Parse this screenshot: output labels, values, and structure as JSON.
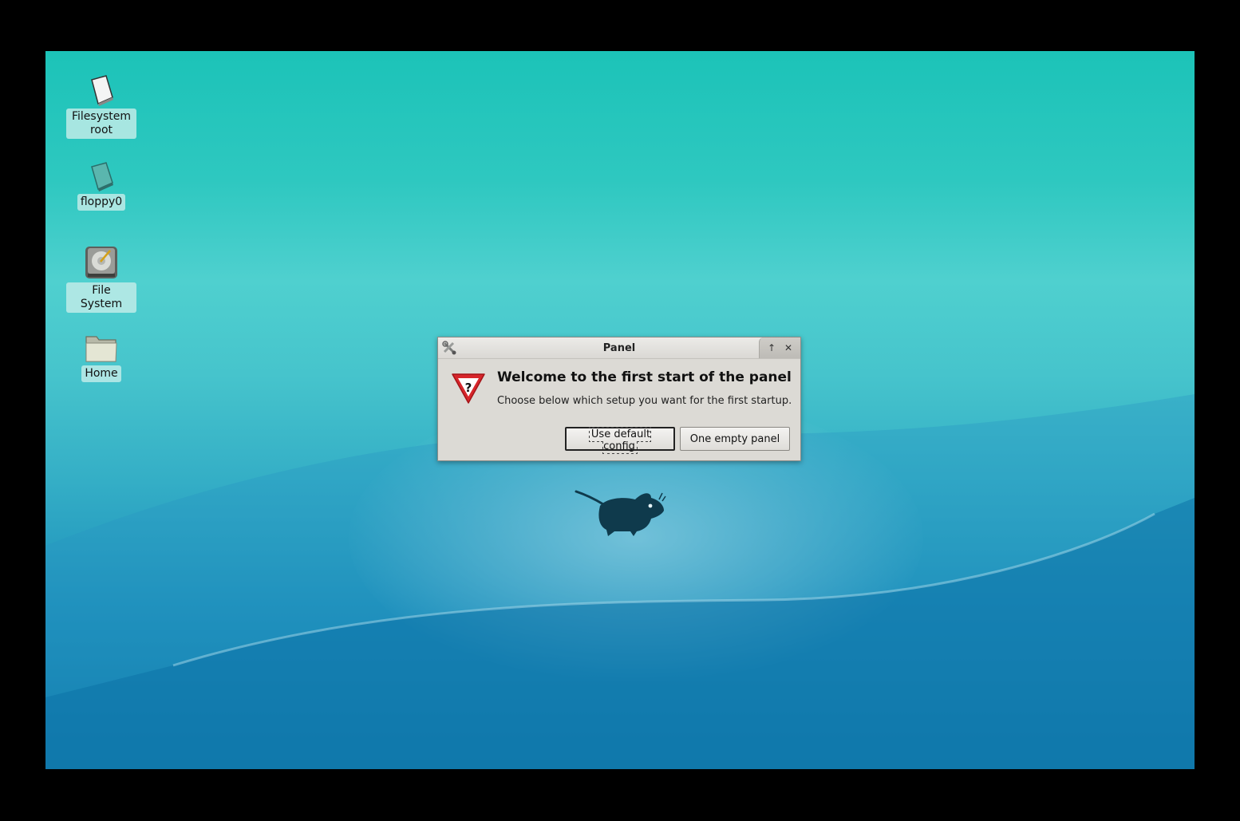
{
  "desktop": {
    "icons": [
      {
        "label": "Filesystem root",
        "icon": "drive-icon"
      },
      {
        "label": "floppy0",
        "icon": "floppy-icon"
      },
      {
        "label": "File System",
        "icon": "harddisk-icon"
      },
      {
        "label": "Home",
        "icon": "folder-icon"
      }
    ]
  },
  "dialog": {
    "title": "Panel",
    "heading": "Welcome to the first start of the panel",
    "message": "Choose below which setup you want for the first startup.",
    "buttons": {
      "default_config": "Use default config",
      "empty_panel": "One empty panel"
    },
    "titlebar_buttons": {
      "maximize": "↑",
      "close": "✕"
    }
  },
  "colors": {
    "accent_warning": "#d7262b",
    "dialog_bg": "#dcdad5"
  }
}
